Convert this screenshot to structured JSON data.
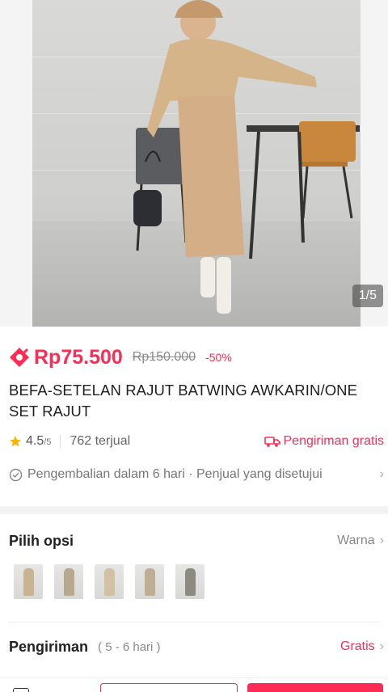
{
  "hero": {
    "image_counter": "1/5"
  },
  "product": {
    "price": "Rp75.500",
    "original_price": "Rp150.000",
    "discount": "-50%",
    "title": "BEFA-SETELAN RAJUT BATWING AWKARIN/ONE SET RAJUT",
    "rating": "4.5",
    "rating_max": "/5",
    "sold": "762 terjual",
    "free_shipping": "Pengiriman gratis",
    "return_policy": "Pengembalian dalam 6 hari · Penjual yang disetujui"
  },
  "options": {
    "title": "Pilih opsi",
    "variant_label": "Warna",
    "thumbnails": [
      {
        "name": "variant-thumb-1",
        "color": "#c9b393"
      },
      {
        "name": "variant-thumb-2",
        "color": "#b8a98e"
      },
      {
        "name": "variant-thumb-3",
        "color": "#d3c1a6"
      },
      {
        "name": "variant-thumb-4",
        "color": "#bfae93"
      },
      {
        "name": "variant-thumb-5",
        "color": "#8d8a80"
      }
    ]
  },
  "shipping": {
    "title": "Pengiriman",
    "days": "( 5 - 6 hari )",
    "cost": "Gratis"
  },
  "colors": {
    "accent": "#fe2c55"
  }
}
